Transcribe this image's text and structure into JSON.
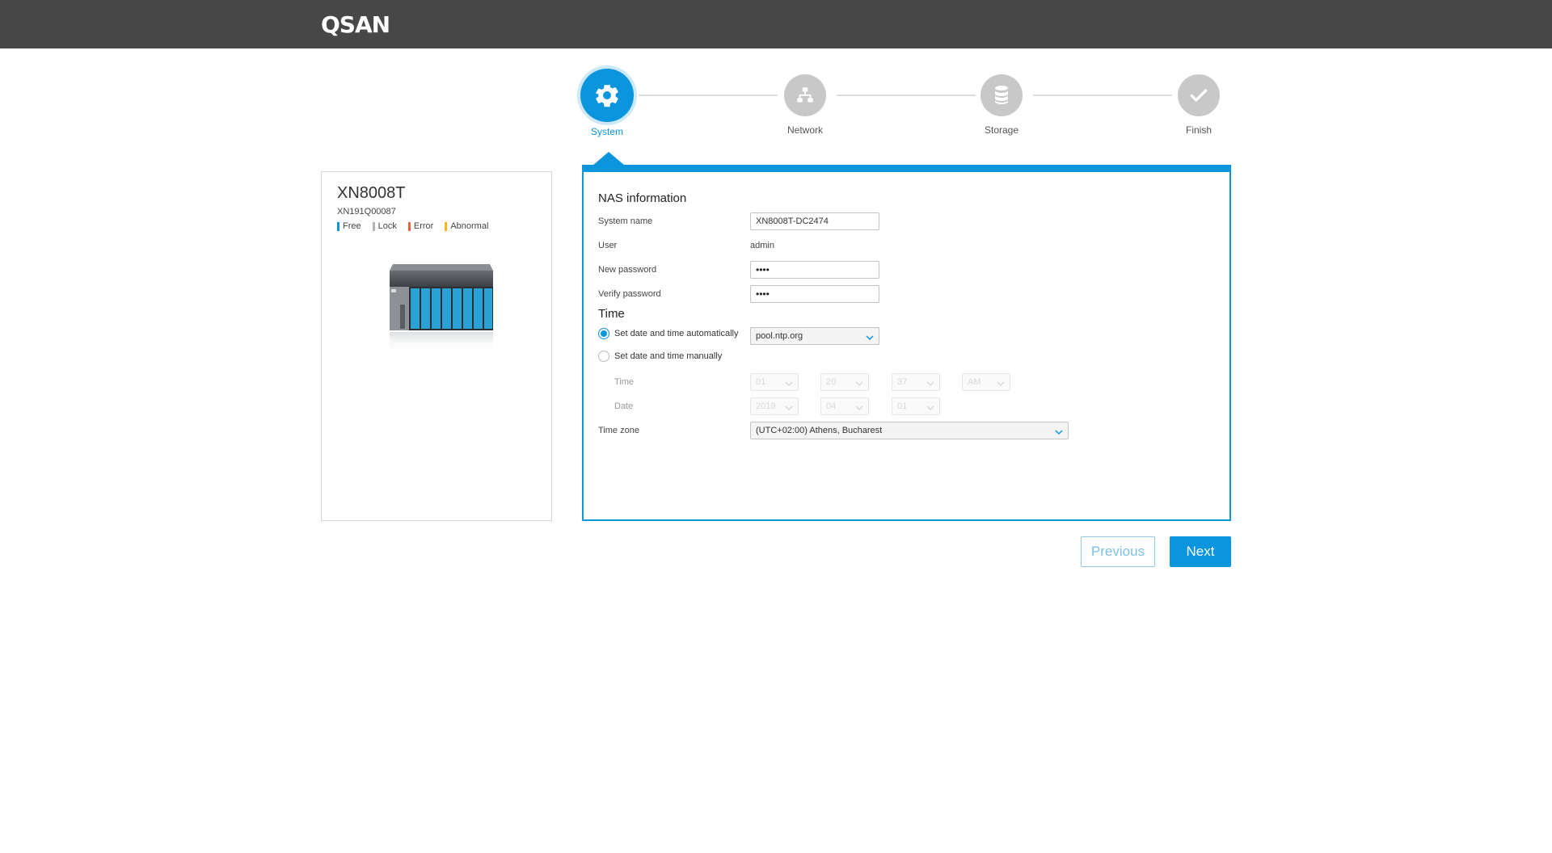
{
  "header": {
    "logo": "QSAN"
  },
  "steps": [
    {
      "label": "System",
      "active": true,
      "icon": "gear-icon"
    },
    {
      "label": "Network",
      "active": false,
      "icon": "network-icon"
    },
    {
      "label": "Storage",
      "active": false,
      "icon": "database-icon"
    },
    {
      "label": "Finish",
      "active": false,
      "icon": "checkmark-icon"
    }
  ],
  "device": {
    "model": "XN8008T",
    "serial": "XN191Q00087",
    "legend": [
      {
        "label": "Free",
        "color": "#0b95dd"
      },
      {
        "label": "Lock",
        "color": "#b5b5b5"
      },
      {
        "label": "Error",
        "color": "#f0603c"
      },
      {
        "label": "Abnormal",
        "color": "#f6b91c"
      }
    ]
  },
  "form": {
    "nas_title": "NAS information",
    "system_name_label": "System name",
    "system_name_value": "XN8008T-DC2474",
    "user_label": "User",
    "user_value": "admin",
    "new_password_label": "New password",
    "new_password_value": "••••",
    "verify_password_label": "Verify password",
    "verify_password_value": "••••",
    "time_title": "Time",
    "auto_label": "Set date and time automatically",
    "ntp_server": "pool.ntp.org",
    "manual_label": "Set date and time manually",
    "time_label": "Time",
    "time_hour": "01",
    "time_minute": "20",
    "time_second": "37",
    "time_ampm": "AM",
    "date_label": "Date",
    "date_year": "2019",
    "date_month": "04",
    "date_day": "01",
    "timezone_label": "Time zone",
    "timezone_value": "(UTC+02:00) Athens, Bucharest"
  },
  "buttons": {
    "previous": "Previous",
    "next": "Next"
  },
  "colors": {
    "accent": "#0b95dd",
    "topbar": "#474747"
  }
}
